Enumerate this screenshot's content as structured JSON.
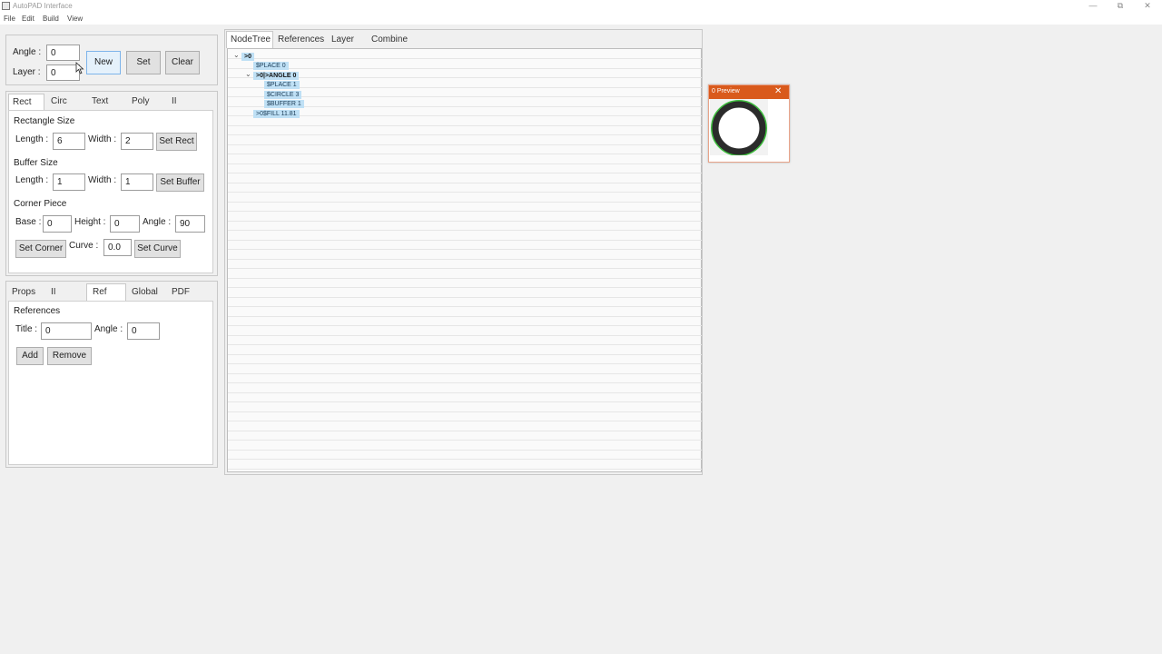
{
  "app": {
    "title": "AutoPAD Interface",
    "window_controls": {
      "minimize": "—",
      "maximize": "⧉",
      "close": "✕"
    }
  },
  "menu": [
    "File",
    "Edit",
    "Build",
    "View"
  ],
  "top_panel": {
    "angle_label": "Angle :",
    "angle_value": "0",
    "layer_label": "Layer :",
    "layer_value": "0",
    "new_button": "New",
    "set_button": "Set",
    "clear_button": "Clear"
  },
  "shape_tabs": [
    "Rect",
    "Circ",
    "Text",
    "Poly",
    "II"
  ],
  "rect_panel": {
    "rect_size_title": "Rectangle Size",
    "length_label": "Length :",
    "rect_length": "6",
    "width_label": "Width :",
    "rect_width": "2",
    "set_rect_button": "Set Rect",
    "buffer_title": "Buffer Size",
    "buffer_length": "1",
    "buffer_width": "1",
    "set_buffer_button": "Set Buffer",
    "corner_title": "Corner Piece",
    "base_label": "Base :",
    "base_value": "0",
    "height_label": "Height :",
    "height_value": "0",
    "corner_angle_label": "Angle :",
    "corner_angle_value": "90",
    "set_corner_button": "Set Corner",
    "curve_label": "Curve :",
    "curve_value": "0.0",
    "set_curve_button": "Set Curve"
  },
  "bottom_tabs": [
    "Props",
    "II",
    "Ref",
    "Global",
    "PDF"
  ],
  "ref_panel": {
    "title": "References",
    "title_label": "Title :",
    "title_value": "0",
    "angle_label": "Angle :",
    "angle_value": "0",
    "add_button": "Add",
    "remove_button": "Remove"
  },
  "tree_tabs": [
    "NodeTree",
    "References",
    "Layer",
    "Combine"
  ],
  "tree": {
    "nodes": [
      ">0",
      "$PLACE 0",
      ">0|>ANGLE 0",
      "$PLACE 1",
      "$CIRCLE 3",
      "$BUFFER 1",
      ">0$FILL 11.81"
    ],
    "expand_glyph": "⌄"
  },
  "preview": {
    "title": "0 Preview",
    "close": "✕",
    "colors": {
      "header": "#d95a1c",
      "ring": "#2b2b2b",
      "outline": "#3fbf3f"
    }
  }
}
